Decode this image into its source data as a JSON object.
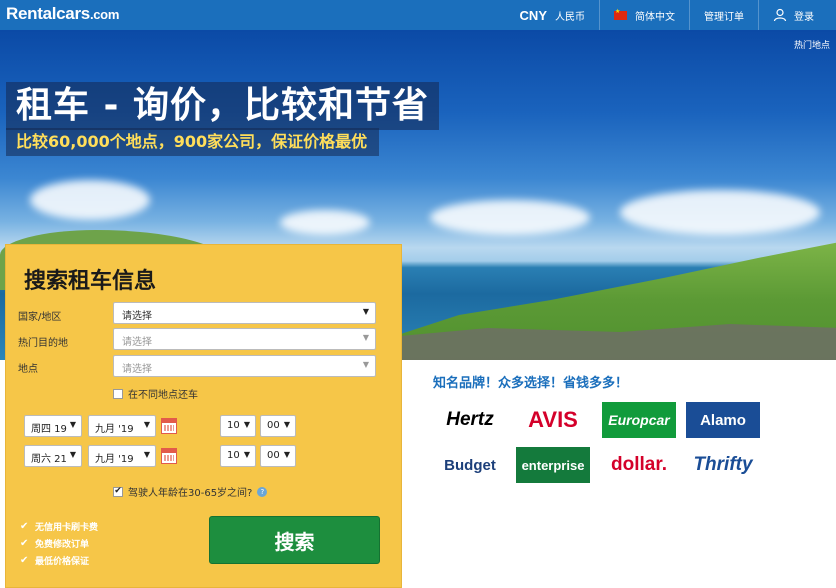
{
  "header": {
    "logo": "Rentalcars",
    "logo_suffix": ".com",
    "currency_code": "CNY",
    "currency_name": "人民币",
    "language": "简体中文",
    "manage_booking": "管理订单",
    "login": "登录",
    "icons": {
      "flag": "china-flag-icon",
      "user": "user-icon"
    }
  },
  "hero": {
    "title": "租车 - 询价，比较和节省",
    "subtitle": "比较60,000个地点，900家公司，保证价格最优",
    "hot_link": "热门地点"
  },
  "search": {
    "title": "搜索租车信息",
    "country_label": "国家/地区",
    "country_value": "请选择",
    "destination_label": "热门目的地",
    "destination_value": "请选择",
    "location_label": "地点",
    "location_value": "请选择",
    "different_return": "在不同地点还车",
    "pickup": {
      "day": "周四 19",
      "month": "九月 '19",
      "hour": "10",
      "minute": "00"
    },
    "dropoff": {
      "day": "周六 21",
      "month": "九月 '19",
      "hour": "10",
      "minute": "00"
    },
    "age_check": "驾驶人年龄在30-65岁之间?",
    "age_checked": true,
    "button": "搜索"
  },
  "benefits": [
    "无信用卡刷卡费",
    "免费修改订单",
    "最低价格保证"
  ],
  "brands": {
    "title": "知名品牌！众多选择！省钱多多！",
    "items": [
      {
        "name": "Hertz",
        "color": "#000000",
        "bg": "#ffffff"
      },
      {
        "name": "AVIS",
        "color": "#d4002a",
        "bg": "#ffffff"
      },
      {
        "name": "Europcar",
        "color": "#ffffff",
        "bg": "#119b3b"
      },
      {
        "name": "Alamo",
        "color": "#ffffff",
        "bg": "#1a4d96"
      },
      {
        "name": "Budget",
        "color": "#1c3f7a",
        "bg": "#ffffff"
      },
      {
        "name": "enterprise",
        "color": "#ffffff",
        "bg": "#147a3c"
      },
      {
        "name": "dollar.",
        "color": "#d4002a",
        "bg": "#ffffff"
      },
      {
        "name": "Thrifty",
        "color": "#1a4d96",
        "bg": "#ffffff"
      }
    ]
  }
}
